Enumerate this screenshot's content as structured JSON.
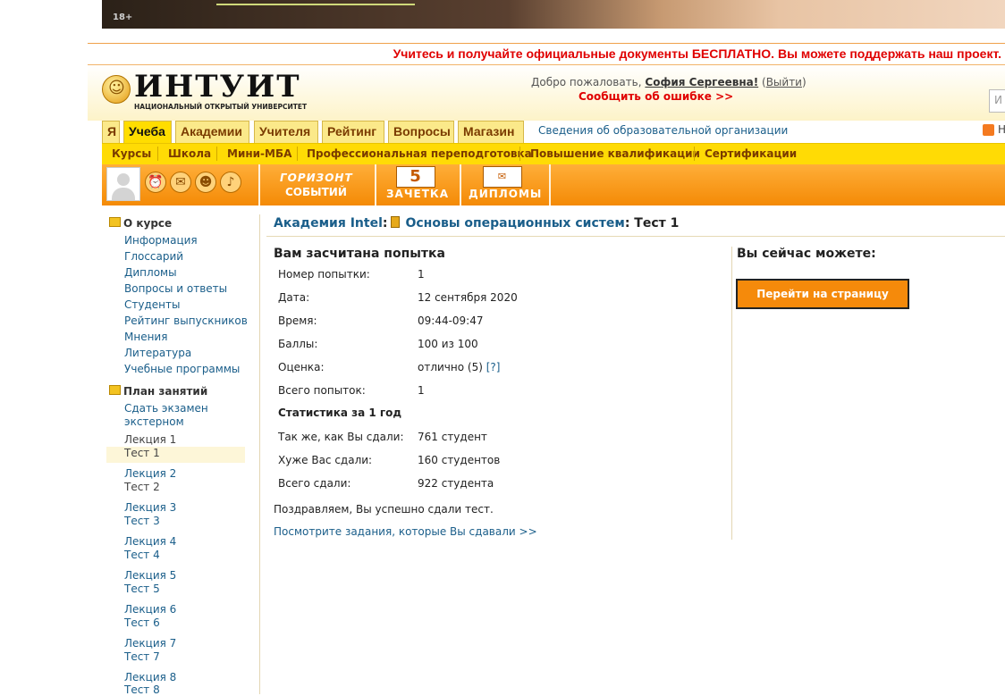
{
  "banner": {
    "age_label": "18+"
  },
  "promo": {
    "text": "Учитесь и получайте официальные документы БЕСПЛАТНО. Вы можете поддержать наш проект."
  },
  "header": {
    "logo_word": "ИНТУИТ",
    "logo_sub": "НАЦИОНАЛЬНЫЙ ОТКРЫТЫЙ УНИВЕРСИТЕТ",
    "welcome_prefix": "Добро пожаловать,",
    "user_name": "София Сергеевна!",
    "logout": "Выйти",
    "report_error": "Сообщить об ошибке >>",
    "search_stub": "И"
  },
  "tabs": [
    "Я",
    "Учеба",
    "Академии",
    "Учителя",
    "Рейтинг",
    "Вопросы",
    "Магазин"
  ],
  "org_info": "Сведения об образовательной организации",
  "rss_tail": "Н",
  "subnav": [
    "Курсы",
    "Школа",
    "Мини-МБА",
    "Профессиональная переподготовка",
    "Повышение квалификации",
    "Сертификации"
  ],
  "toolbar": {
    "horizon_1": "ГОРИЗОНТ",
    "horizon_2": "СОБЫТИЙ",
    "gradebook_num": "5",
    "gradebook": "ЗАЧЕТКА",
    "diplomas": "ДИПЛОМЫ"
  },
  "sidebar": {
    "about_title": "О курсе",
    "about_links": [
      "Информация",
      "Глоссарий",
      "Дипломы",
      "Вопросы и ответы",
      "Студенты",
      "Рейтинг выпускников",
      "Мнения",
      "Литература",
      "Учебные программы"
    ],
    "plan_title": "План занятий",
    "exam_1": "Сдать экзамен",
    "exam_2": "экстерном",
    "lessons": [
      {
        "lecture": "Лекция 1",
        "test": "Тест 1"
      },
      {
        "lecture": "Лекция 2",
        "test": "Тест 2"
      },
      {
        "lecture": "Лекция 3",
        "test": "Тест 3"
      },
      {
        "lecture": "Лекция 4",
        "test": "Тест 4"
      },
      {
        "lecture": "Лекция 5",
        "test": "Тест 5"
      },
      {
        "lecture": "Лекция 6",
        "test": "Тест 6"
      },
      {
        "lecture": "Лекция 7",
        "test": "Тест 7"
      },
      {
        "lecture": "Лекция 8",
        "test": "Тест 8"
      }
    ]
  },
  "breadcrumb": {
    "academy": "Академия Intel",
    "course": "Основы операционных систем",
    "current": "Тест 1"
  },
  "result": {
    "title": "Вам засчитана попытка",
    "rows": [
      {
        "label": "Номер попытки:",
        "value": "1"
      },
      {
        "label": "Дата:",
        "value": "12 сентября 2020"
      },
      {
        "label": "Время:",
        "value": "09:44-09:47"
      },
      {
        "label": "Баллы:",
        "value": "100 из 100"
      },
      {
        "label": "Оценка:",
        "value": "отлично (5)"
      },
      {
        "label": "Всего попыток:",
        "value": "1"
      }
    ],
    "grade_help": "[?]",
    "stats_title": "Статистика за 1 год",
    "stats": [
      {
        "label": "Так же, как Вы сдали:",
        "value": "761 студент"
      },
      {
        "label": "Хуже Вас сдали:",
        "value": "160 студентов"
      },
      {
        "label": "Всего сдали:",
        "value": "922 студента"
      }
    ],
    "congrats": "Поздравляем, Вы успешно сдали тест.",
    "view_tasks": "Посмотрите задания, которые Вы сдавали >>"
  },
  "actions": {
    "title": "Вы сейчас можете:",
    "go_course": "Перейти на страницу курса"
  }
}
